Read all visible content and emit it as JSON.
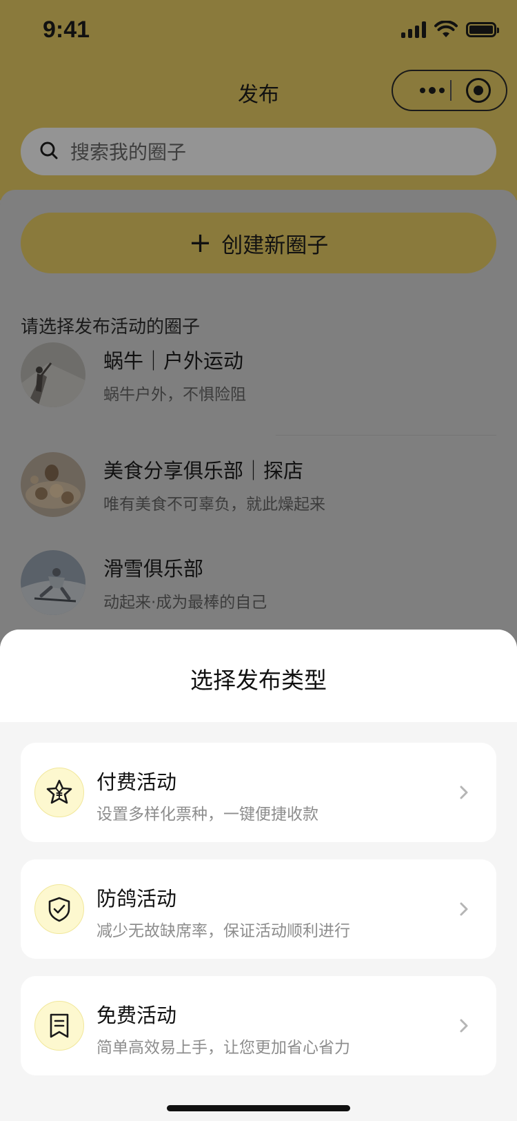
{
  "status_bar": {
    "time": "9:41"
  },
  "nav": {
    "title": "发布"
  },
  "search": {
    "placeholder": "搜索我的圈子"
  },
  "create_button": {
    "plus": "+",
    "label": "创建新圈子"
  },
  "section_label": "请选择发布活动的圈子",
  "circles": [
    {
      "title": "蜗牛｜户外运动",
      "subtitle": "蜗牛户外，不惧险阻"
    },
    {
      "title": "美食分享俱乐部｜探店",
      "subtitle": "唯有美食不可辜负，就此燥起来"
    },
    {
      "title": "滑雪俱乐部",
      "subtitle": "动起来·成为最棒的自己"
    }
  ],
  "sheet": {
    "title": "选择发布类型",
    "options": [
      {
        "title": "付费活动",
        "desc": "设置多样化票种，一键便捷收款",
        "icon": "star-yen-icon"
      },
      {
        "title": "防鸽活动",
        "desc": "减少无故缺席率，保证活动顺利进行",
        "icon": "shield-check-icon"
      },
      {
        "title": "免费活动",
        "desc": "简单高效易上手，让您更加省心省力",
        "icon": "receipt-icon"
      }
    ]
  },
  "colors": {
    "accent_yellow": "#F4E04D",
    "dimmed_accent": "#8A7A3C",
    "icon_bg": "#FDF8CF",
    "sheet_bg": "#F5F5F5",
    "muted_text": "#8D8D8D"
  }
}
